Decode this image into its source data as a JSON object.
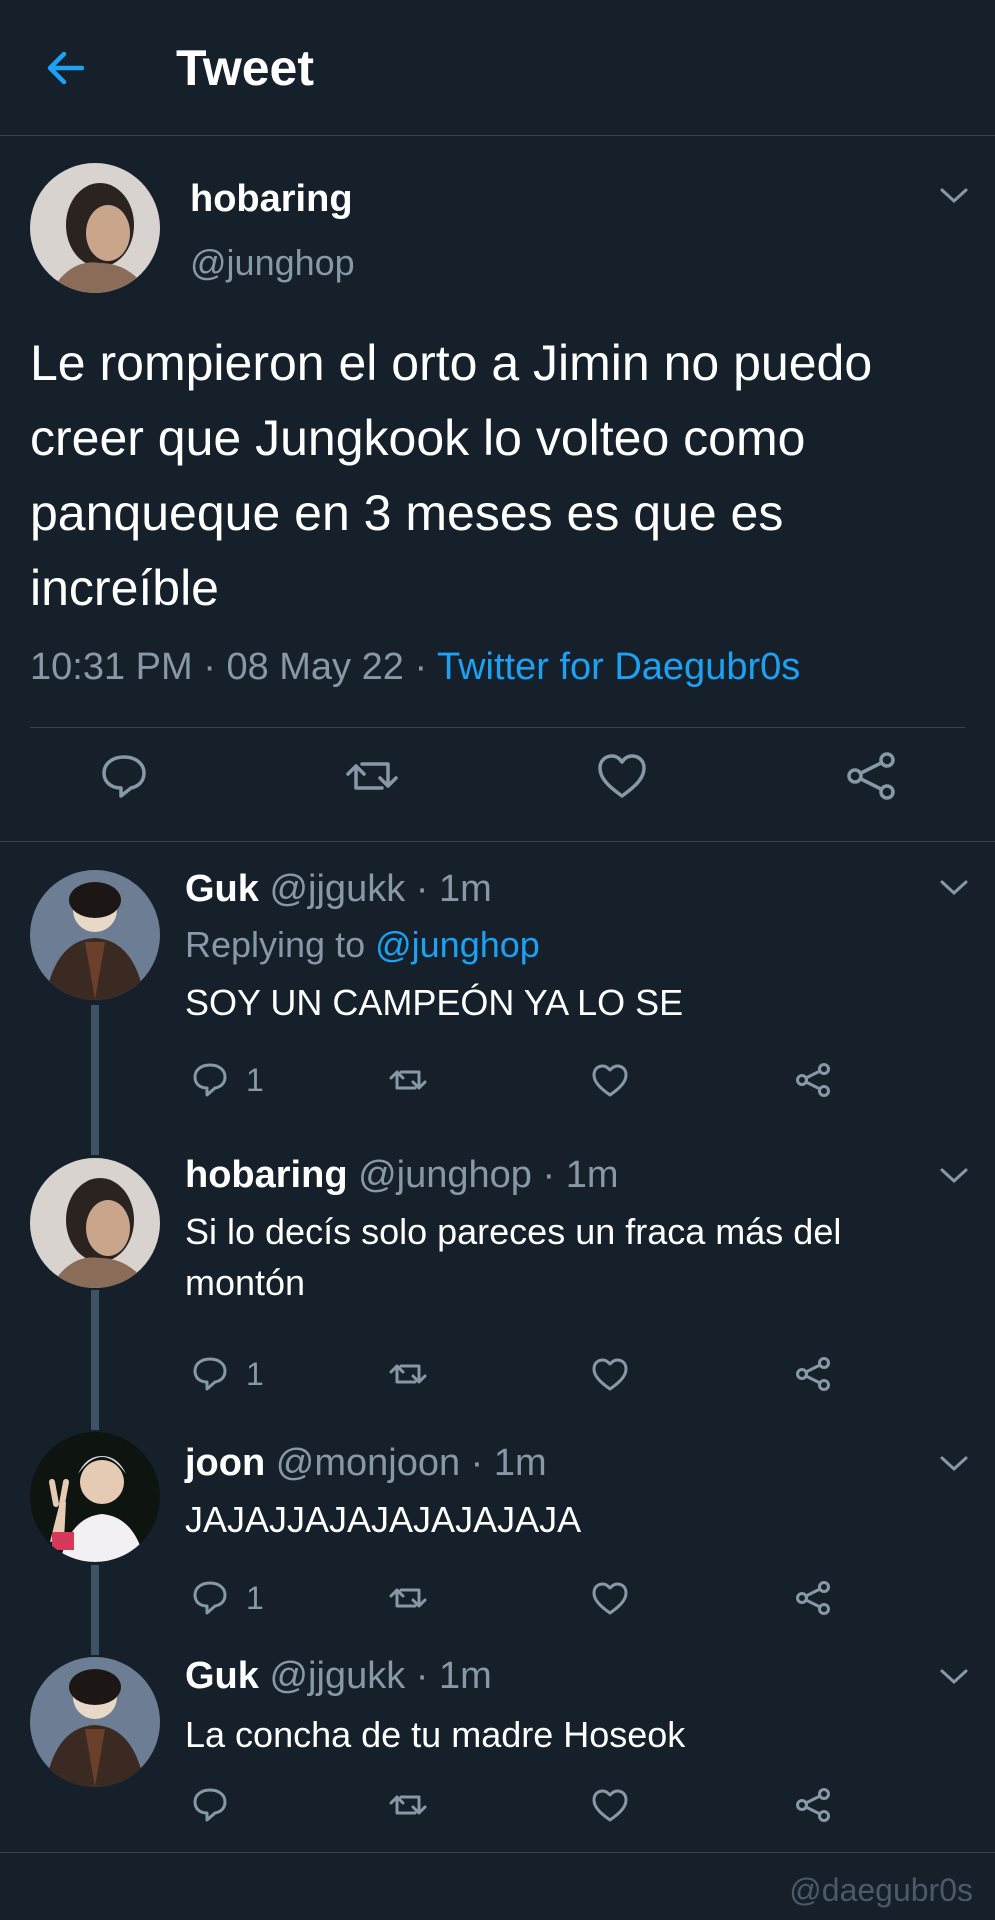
{
  "header": {
    "title": "Tweet"
  },
  "tweet": {
    "name": "hobaring",
    "handle": "@junghop",
    "text": "Le rompieron el orto a Jimin no puedo creer que Jungkook lo volteo como panqueque en 3 meses es que es increíble",
    "time": "10:31 PM",
    "date": "08 May 22",
    "dot": " · ",
    "source": "Twitter for Daegubr0s"
  },
  "replies": [
    {
      "name": "Guk",
      "handle": "@jjgukk",
      "time": " · 1m",
      "replying_label": "Replying to ",
      "replying_to": "@junghop",
      "text": "SOY UN CAMPEÓN YA LO SE",
      "reply_count": "1"
    },
    {
      "name": "hobaring",
      "handle": "@junghop",
      "time": " · 1m",
      "text": "Si lo decís solo pareces un fraca más del montón",
      "reply_count": "1"
    },
    {
      "name": "joon",
      "handle": "@monjoon",
      "time": " · 1m",
      "text": "JAJAJJAJAJAJAJAJAJA",
      "reply_count": "1"
    },
    {
      "name": "Guk",
      "handle": "@jjgukk",
      "time": " · 1m",
      "text": "La concha de tu madre Hoseok",
      "reply_count": ""
    }
  ],
  "watermark": "@daegubr0s",
  "colors": {
    "background": "#15202b",
    "divider": "#38444d",
    "accent": "#1da1f2",
    "secondary_text": "#8899a6",
    "thread_line": "#3d5466"
  },
  "icons": {
    "back": "arrow-left-icon",
    "caret": "chevron-down-icon",
    "reply": "comment-icon",
    "retweet": "retweet-icon",
    "like": "heart-icon",
    "share": "share-icon"
  }
}
